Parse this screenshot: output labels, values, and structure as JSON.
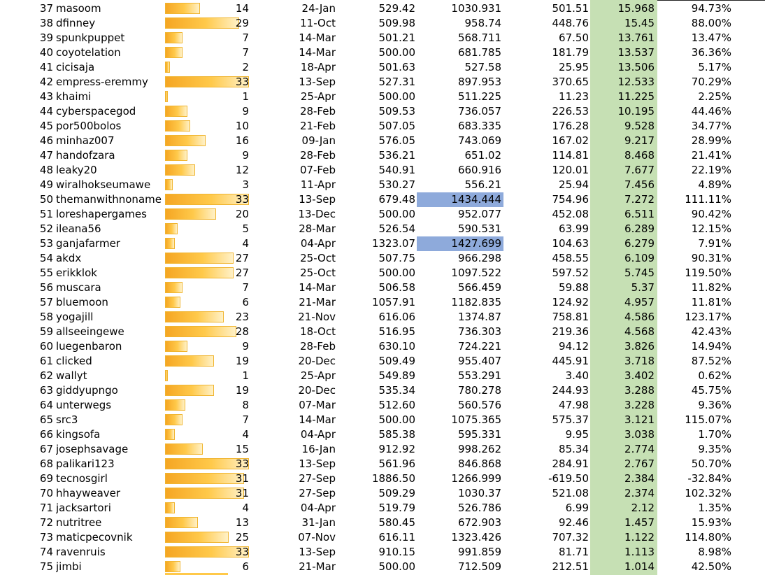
{
  "rows": [
    {
      "rank": "37",
      "name": "masoom",
      "count": "14",
      "bar": 0.42,
      "date": "24-Jan",
      "c1": "529.42",
      "c2": "1030.931",
      "c3": "501.51",
      "c4": "15.968",
      "c5": "94.73%"
    },
    {
      "rank": "38",
      "name": "dfinney",
      "count": "29",
      "bar": 0.88,
      "date": "11-Oct",
      "c1": "509.98",
      "c2": "958.74",
      "c3": "448.76",
      "c4": "15.45",
      "c5": "88.00%"
    },
    {
      "rank": "39",
      "name": "spunkpuppet",
      "count": "7",
      "bar": 0.21,
      "date": "14-Mar",
      "c1": "501.21",
      "c2": "568.711",
      "c3": "67.50",
      "c4": "13.761",
      "c5": "13.47%"
    },
    {
      "rank": "40",
      "name": "coyotelation",
      "count": "7",
      "bar": 0.21,
      "date": "14-Mar",
      "c1": "500.00",
      "c2": "681.785",
      "c3": "181.79",
      "c4": "13.537",
      "c5": "36.36%"
    },
    {
      "rank": "41",
      "name": "cicisaja",
      "count": "2",
      "bar": 0.06,
      "date": "18-Apr",
      "c1": "501.63",
      "c2": "527.58",
      "c3": "25.95",
      "c4": "13.506",
      "c5": "5.17%"
    },
    {
      "rank": "42",
      "name": "empress-eremmy",
      "count": "33",
      "bar": 1.0,
      "date": "13-Sep",
      "c1": "527.31",
      "c2": "897.953",
      "c3": "370.65",
      "c4": "12.533",
      "c5": "70.29%"
    },
    {
      "rank": "43",
      "name": "khaimi",
      "count": "1",
      "bar": 0.03,
      "date": "25-Apr",
      "c1": "500.00",
      "c2": "511.225",
      "c3": "11.23",
      "c4": "11.225",
      "c5": "2.25%"
    },
    {
      "rank": "44",
      "name": "cyberspacegod",
      "count": "9",
      "bar": 0.27,
      "date": "28-Feb",
      "c1": "509.53",
      "c2": "736.057",
      "c3": "226.53",
      "c4": "10.195",
      "c5": "44.46%"
    },
    {
      "rank": "45",
      "name": "por500bolos",
      "count": "10",
      "bar": 0.3,
      "date": "21-Feb",
      "c1": "507.05",
      "c2": "683.335",
      "c3": "176.28",
      "c4": "9.528",
      "c5": "34.77%"
    },
    {
      "rank": "46",
      "name": "minhaz007",
      "count": "16",
      "bar": 0.48,
      "date": "09-Jan",
      "c1": "576.05",
      "c2": "743.069",
      "c3": "167.02",
      "c4": "9.217",
      "c5": "28.99%"
    },
    {
      "rank": "47",
      "name": "handofzara",
      "count": "9",
      "bar": 0.27,
      "date": "28-Feb",
      "c1": "536.21",
      "c2": "651.02",
      "c3": "114.81",
      "c4": "8.468",
      "c5": "21.41%"
    },
    {
      "rank": "48",
      "name": "leaky20",
      "count": "12",
      "bar": 0.36,
      "date": "07-Feb",
      "c1": "540.91",
      "c2": "660.916",
      "c3": "120.01",
      "c4": "7.677",
      "c5": "22.19%"
    },
    {
      "rank": "49",
      "name": "wiralhokseumawe",
      "count": "3",
      "bar": 0.09,
      "date": "11-Apr",
      "c1": "530.27",
      "c2": "556.21",
      "c3": "25.94",
      "c4": "7.456",
      "c5": "4.89%"
    },
    {
      "rank": "50",
      "name": "themanwithnoname",
      "count": "33",
      "bar": 1.0,
      "date": "13-Sep",
      "c1": "679.48",
      "c2": "1434.444",
      "hl": true,
      "c3": "754.96",
      "c4": "7.272",
      "c5": "111.11%"
    },
    {
      "rank": "51",
      "name": "loreshapergames",
      "count": "20",
      "bar": 0.61,
      "date": "13-Dec",
      "c1": "500.00",
      "c2": "952.077",
      "c3": "452.08",
      "c4": "6.511",
      "c5": "90.42%"
    },
    {
      "rank": "52",
      "name": "ileana56",
      "count": "5",
      "bar": 0.15,
      "date": "28-Mar",
      "c1": "526.54",
      "c2": "590.531",
      "c3": "63.99",
      "c4": "6.289",
      "c5": "12.15%"
    },
    {
      "rank": "53",
      "name": "ganjafarmer",
      "count": "4",
      "bar": 0.12,
      "date": "04-Apr",
      "c1": "1323.07",
      "c2": "1427.699",
      "hl": true,
      "c3": "104.63",
      "c4": "6.279",
      "c5": "7.91%"
    },
    {
      "rank": "54",
      "name": "akdx",
      "count": "27",
      "bar": 0.82,
      "date": "25-Oct",
      "c1": "507.75",
      "c2": "966.298",
      "c3": "458.55",
      "c4": "6.109",
      "c5": "90.31%"
    },
    {
      "rank": "55",
      "name": "erikklok",
      "count": "27",
      "bar": 0.82,
      "date": "25-Oct",
      "c1": "500.00",
      "c2": "1097.522",
      "c3": "597.52",
      "c4": "5.745",
      "c5": "119.50%"
    },
    {
      "rank": "56",
      "name": "muscara",
      "count": "7",
      "bar": 0.21,
      "date": "14-Mar",
      "c1": "506.58",
      "c2": "566.459",
      "c3": "59.88",
      "c4": "5.37",
      "c5": "11.82%"
    },
    {
      "rank": "57",
      "name": "bluemoon",
      "count": "6",
      "bar": 0.18,
      "date": "21-Mar",
      "c1": "1057.91",
      "c2": "1182.835",
      "c3": "124.92",
      "c4": "4.957",
      "c5": "11.81%"
    },
    {
      "rank": "58",
      "name": "yogajill",
      "count": "23",
      "bar": 0.7,
      "date": "21-Nov",
      "c1": "616.06",
      "c2": "1374.87",
      "c3": "758.81",
      "c4": "4.586",
      "c5": "123.17%"
    },
    {
      "rank": "59",
      "name": "allseeingewe",
      "count": "28",
      "bar": 0.85,
      "date": "18-Oct",
      "c1": "516.95",
      "c2": "736.303",
      "c3": "219.36",
      "c4": "4.568",
      "c5": "42.43%"
    },
    {
      "rank": "60",
      "name": "luegenbaron",
      "count": "9",
      "bar": 0.27,
      "date": "28-Feb",
      "c1": "630.10",
      "c2": "724.221",
      "c3": "94.12",
      "c4": "3.826",
      "c5": "14.94%"
    },
    {
      "rank": "61",
      "name": "clicked",
      "count": "19",
      "bar": 0.58,
      "date": "20-Dec",
      "c1": "509.49",
      "c2": "955.407",
      "c3": "445.91",
      "c4": "3.718",
      "c5": "87.52%"
    },
    {
      "rank": "62",
      "name": "wallyt",
      "count": "1",
      "bar": 0.03,
      "date": "25-Apr",
      "c1": "549.89",
      "c2": "553.291",
      "c3": "3.40",
      "c4": "3.402",
      "c5": "0.62%"
    },
    {
      "rank": "63",
      "name": "giddyupngo",
      "count": "19",
      "bar": 0.58,
      "date": "20-Dec",
      "c1": "535.34",
      "c2": "780.278",
      "c3": "244.93",
      "c4": "3.288",
      "c5": "45.75%"
    },
    {
      "rank": "64",
      "name": "unterwegs",
      "count": "8",
      "bar": 0.24,
      "date": "07-Mar",
      "c1": "512.60",
      "c2": "560.576",
      "c3": "47.98",
      "c4": "3.228",
      "c5": "9.36%"
    },
    {
      "rank": "65",
      "name": "src3",
      "count": "7",
      "bar": 0.21,
      "date": "14-Mar",
      "c1": "500.00",
      "c2": "1075.365",
      "c3": "575.37",
      "c4": "3.121",
      "c5": "115.07%"
    },
    {
      "rank": "66",
      "name": "kingsofa",
      "count": "4",
      "bar": 0.12,
      "date": "04-Apr",
      "c1": "585.38",
      "c2": "595.331",
      "c3": "9.95",
      "c4": "3.038",
      "c5": "1.70%"
    },
    {
      "rank": "67",
      "name": "josephsavage",
      "count": "15",
      "bar": 0.45,
      "date": "16-Jan",
      "c1": "912.92",
      "c2": "998.262",
      "c3": "85.34",
      "c4": "2.774",
      "c5": "9.35%"
    },
    {
      "rank": "68",
      "name": "palikari123",
      "count": "33",
      "bar": 1.0,
      "date": "13-Sep",
      "c1": "561.96",
      "c2": "846.868",
      "c3": "284.91",
      "c4": "2.767",
      "c5": "50.70%"
    },
    {
      "rank": "69",
      "name": "tecnosgirl",
      "count": "31",
      "bar": 0.94,
      "date": "27-Sep",
      "c1": "1886.50",
      "c2": "1266.999",
      "c3": "-619.50",
      "c4": "2.384",
      "c5": "-32.84%"
    },
    {
      "rank": "70",
      "name": "hhayweaver",
      "count": "31",
      "bar": 0.94,
      "date": "27-Sep",
      "c1": "509.29",
      "c2": "1030.37",
      "c3": "521.08",
      "c4": "2.374",
      "c5": "102.32%"
    },
    {
      "rank": "71",
      "name": "jacksartori",
      "count": "4",
      "bar": 0.12,
      "date": "04-Apr",
      "c1": "519.79",
      "c2": "526.786",
      "c3": "6.99",
      "c4": "2.12",
      "c5": "1.35%"
    },
    {
      "rank": "72",
      "name": "nutritree",
      "count": "13",
      "bar": 0.39,
      "date": "31-Jan",
      "c1": "580.45",
      "c2": "672.903",
      "c3": "92.46",
      "c4": "1.457",
      "c5": "15.93%"
    },
    {
      "rank": "73",
      "name": "maticpecovnik",
      "count": "25",
      "bar": 0.76,
      "date": "07-Nov",
      "c1": "616.11",
      "c2": "1323.426",
      "c3": "707.32",
      "c4": "1.122",
      "c5": "114.80%"
    },
    {
      "rank": "74",
      "name": "ravenruis",
      "count": "33",
      "bar": 1.0,
      "date": "13-Sep",
      "c1": "910.15",
      "c2": "991.859",
      "c3": "81.71",
      "c4": "1.113",
      "c5": "8.98%"
    },
    {
      "rank": "75",
      "name": "jimbi",
      "count": "6",
      "bar": 0.18,
      "date": "21-Mar",
      "c1": "500.00",
      "c2": "712.509",
      "c3": "212.51",
      "c4": "1.014",
      "c5": "42.50%"
    }
  ],
  "colors": {
    "highlight_column": "#c6e0b4",
    "highlight_cell": "#8eaadb",
    "databar": "#ffc94a"
  }
}
